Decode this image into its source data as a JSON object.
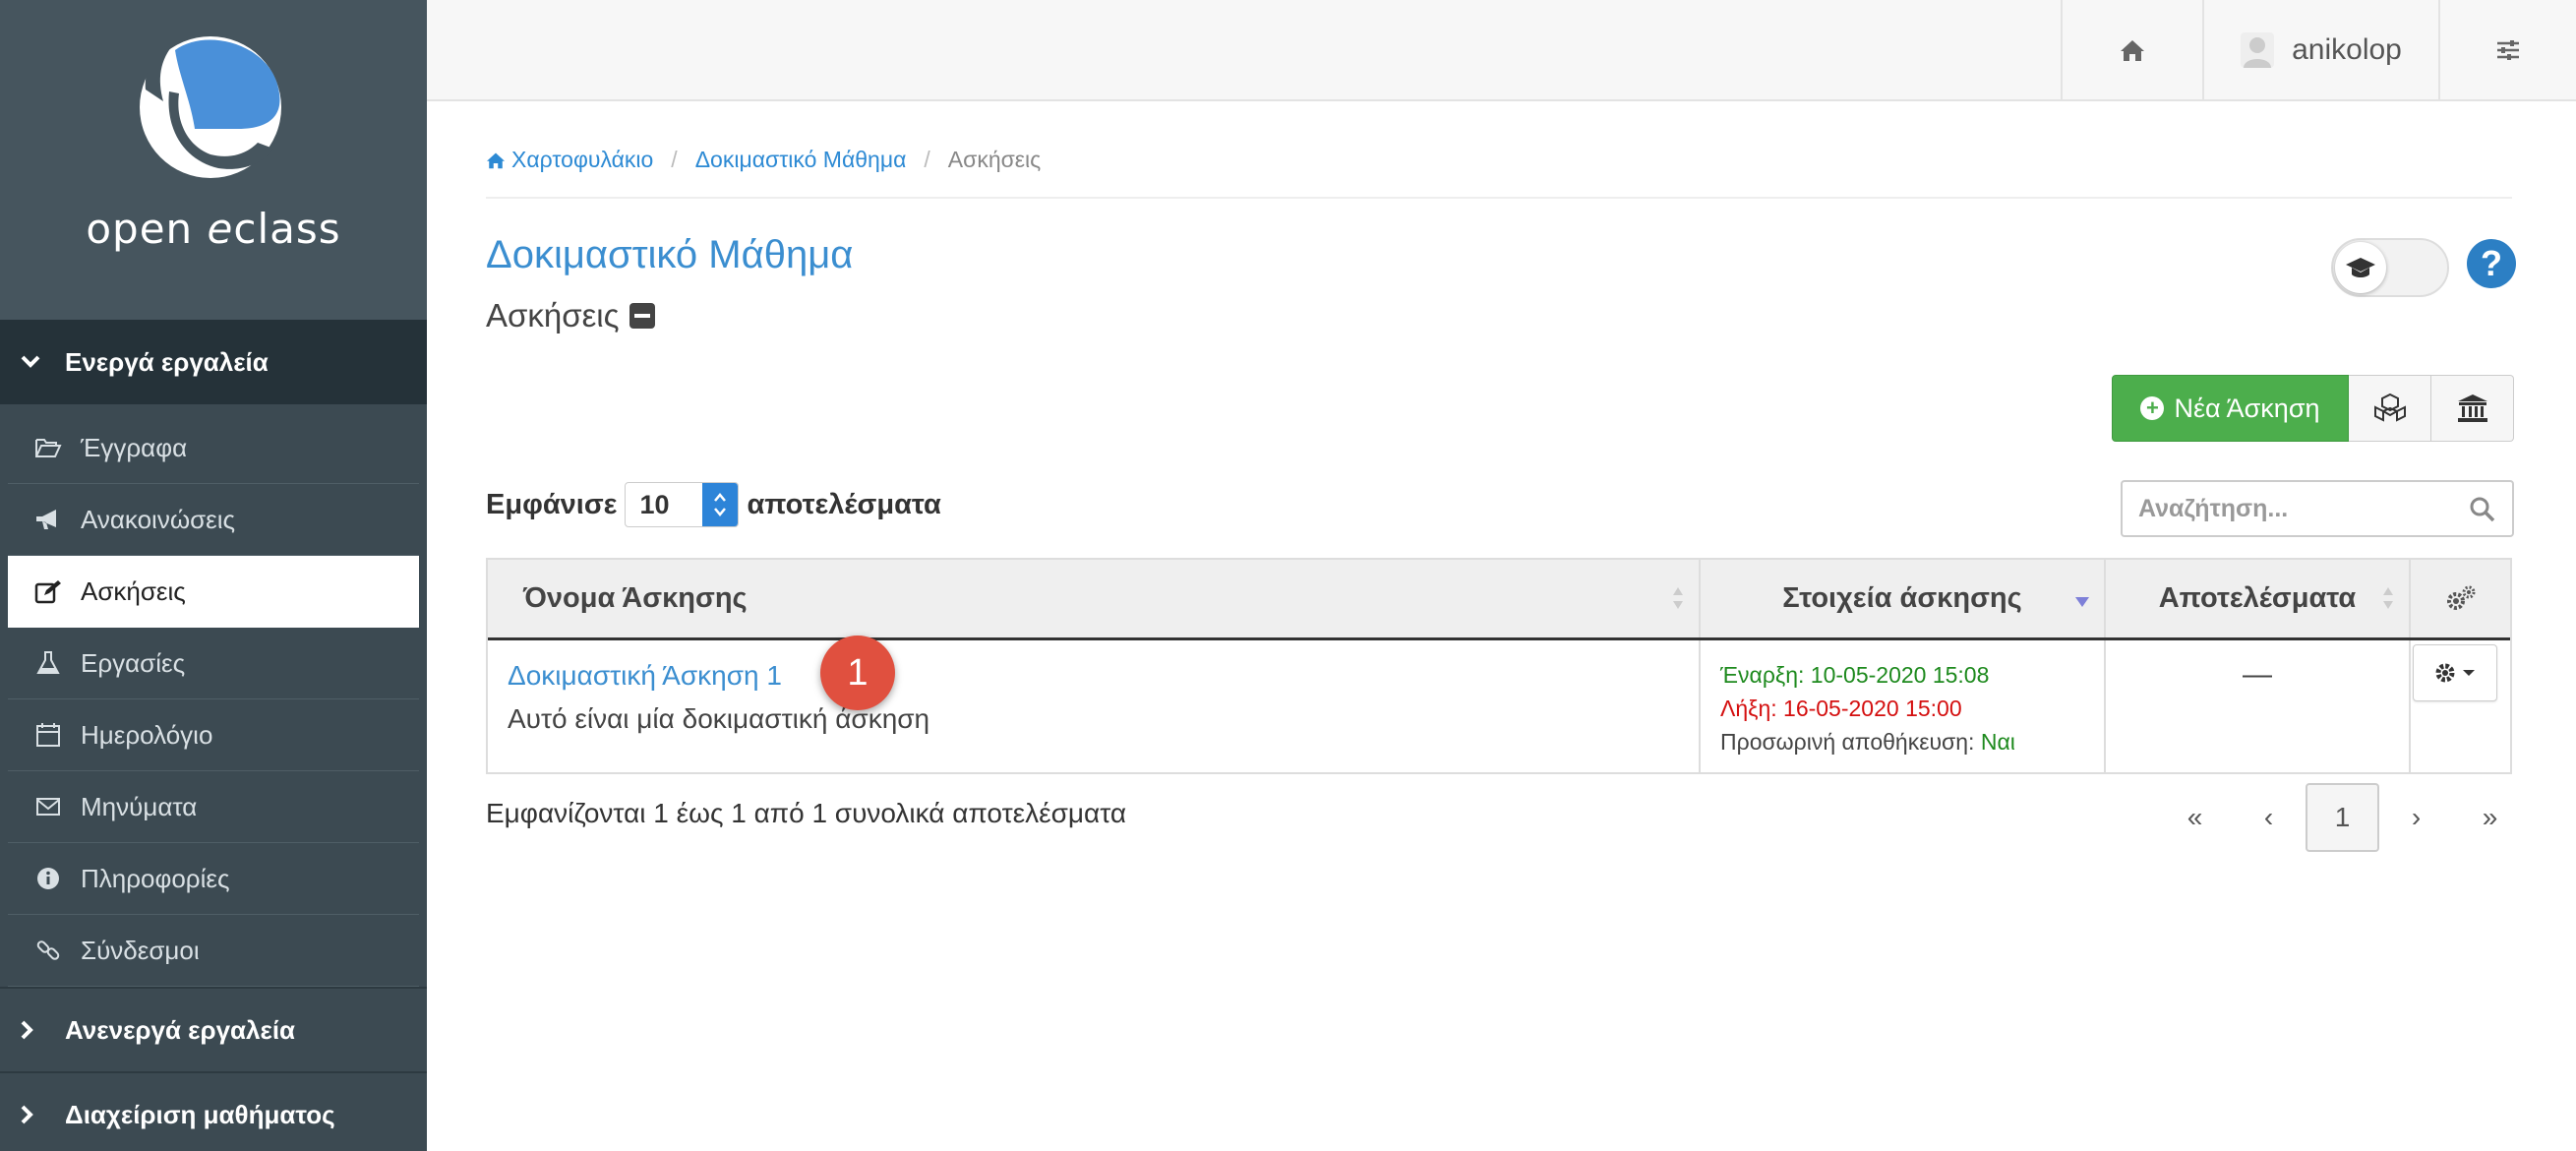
{
  "sidebar": {
    "logo_text_pre": "open ",
    "logo_text_em": "e",
    "logo_text_post": "class",
    "active_group": "Ενεργά εργαλεία",
    "items": [
      {
        "label": "Έγγραφα",
        "icon": "folder-open-icon"
      },
      {
        "label": "Ανακοινώσεις",
        "icon": "bullhorn-icon"
      },
      {
        "label": "Ασκήσεις",
        "icon": "edit-icon",
        "active": true
      },
      {
        "label": "Εργασίες",
        "icon": "flask-icon"
      },
      {
        "label": "Ημερολόγιο",
        "icon": "calendar-icon"
      },
      {
        "label": "Μηνύματα",
        "icon": "envelope-icon"
      },
      {
        "label": "Πληροφορίες",
        "icon": "info-circle-icon"
      },
      {
        "label": "Σύνδεσμοι",
        "icon": "link-icon"
      }
    ],
    "inactive_group": "Ανενεργά εργαλεία",
    "admin_group": "Διαχείριση μαθήματος"
  },
  "topbar": {
    "username": "anikolop"
  },
  "breadcrumb": {
    "home": "Χαρτοφυλάκιο",
    "course": "Δοκιμαστικό Μάθημα",
    "current": "Ασκήσεις"
  },
  "course_title": "Δοκιμαστικό Μάθημα",
  "section_title": "Ασκήσεις",
  "actions": {
    "new_exercise": "Νέα Άσκηση"
  },
  "table_controls": {
    "show_label": "Εμφάνισε",
    "page_length": "10",
    "results_label": "αποτελέσματα",
    "search_placeholder": "Αναζήτηση..."
  },
  "table": {
    "headers": {
      "name": "Όνομα Άσκησης",
      "details": "Στοιχεία άσκησης",
      "results": "Αποτελέσματα"
    },
    "rows": [
      {
        "title": "Δοκιμαστική Άσκηση 1",
        "description": "Αυτό είναι μία δοκιμαστική άσκηση",
        "start": "Έναρξη: 10-05-2020 15:08",
        "end": "Λήξη: 16-05-2020 15:00",
        "temp_save_label": "Προσωρινή αποθήκευση:",
        "temp_save_value": "Ναι",
        "results": "—"
      }
    ]
  },
  "badge": "1",
  "info_text": "Εμφανίζονται 1 έως 1 από 1 συνολικά αποτελέσματα",
  "pagination": {
    "first": "«",
    "prev": "‹",
    "current": "1",
    "next": "›",
    "last": "»"
  },
  "colors": {
    "sidebar_bg": "#3c4a52",
    "accent_blue": "#3b8ed0",
    "success_green": "#4cae4c",
    "badge_red": "#e0503f"
  }
}
